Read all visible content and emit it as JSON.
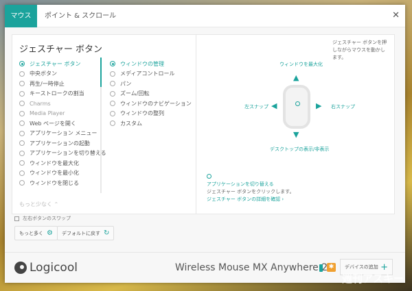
{
  "tabs": [
    "マウス",
    "ポイント & スクロール"
  ],
  "close_icon": "✕",
  "section_title": "ジェスチャー ボタン",
  "buttons_list": [
    {
      "label": "ジェスチャー ボタン",
      "selected": true
    },
    {
      "label": "中央ボタン"
    },
    {
      "label": "再生/一時停止"
    },
    {
      "label": "キーストロークの割当"
    },
    {
      "label": "Charms",
      "dim": true
    },
    {
      "label": "Media Player",
      "dim": true
    },
    {
      "label": "Web ページを開く"
    },
    {
      "label": "アプリケーション メニュー"
    },
    {
      "label": "アプリケーションの起動"
    },
    {
      "label": "アプリケーションを切り替える"
    },
    {
      "label": "ウィンドウを最大化"
    },
    {
      "label": "ウィンドウを最小化"
    },
    {
      "label": "ウィンドウを閉じる"
    }
  ],
  "actions_list": [
    {
      "label": "ウィンドウの管理",
      "selected": true
    },
    {
      "label": "メディアコントロール"
    },
    {
      "label": "パン"
    },
    {
      "label": "ズーム/回転"
    },
    {
      "label": "ウィンドウのナビゲーション"
    },
    {
      "label": "ウィンドウの整列"
    },
    {
      "label": "カスタム"
    }
  ],
  "less_link": "もっと少なく ⌃",
  "hint": "ジェスチャー ボタンを押しながらマウスを動かします。",
  "gestures": {
    "up": "ウィンドウを最大化",
    "left": "左スナップ",
    "right": "右スナップ",
    "down": "デスクトップの表示/非表示"
  },
  "click_action": {
    "title": "アプリケーションを切り替える",
    "desc": "ジェスチャー ボタンをクリックします。",
    "link": "ジェスチャー ボタンの詳細を確認 ›"
  },
  "checkbox_label": "左右ボタンのスワップ",
  "more_button": "もっと多く",
  "default_button": "デフォルトに戻す",
  "brand": "Logicool",
  "device_name": "Wireless Mouse MX Anywhere 2",
  "add_device": "デバイスの追加",
  "watermark": "週刊アスキー",
  "accent": "#1ba39c"
}
